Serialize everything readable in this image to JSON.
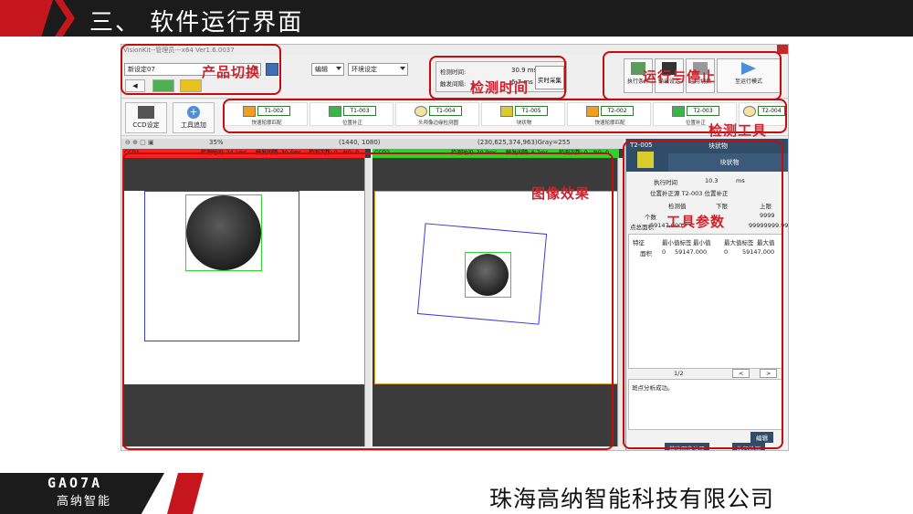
{
  "slide": {
    "title": "三、 软件运行界面",
    "company": "珠海高纳智能科技有限公司",
    "logo_mark": "GAO7A",
    "logo_cn": "高纳智能"
  },
  "app": {
    "window_title": "VisionKit--管理员---x64 Ver1.6.0037",
    "product_select": "新设定07",
    "menu_edit": "编辑",
    "menu_env": "环境设定",
    "stats": {
      "detect_time_label": "检测时间:",
      "detect_time_value": "30.9 ms",
      "trigger_interval_label": "触发间隔:",
      "trigger_interval_value": "6.7 ms",
      "realtime_button": "实时采集"
    },
    "run_buttons": [
      "执行条件",
      "输出设定",
      "运用切换",
      "至运行模式"
    ],
    "toolbar": {
      "ccd_setup": "CCD设定",
      "add_tool": "工具追加"
    },
    "tools": [
      {
        "id": "T1-002",
        "name": "快速轮廓匹配"
      },
      {
        "id": "T1-003",
        "name": "位置补正"
      },
      {
        "id": "T1-004",
        "name": "头颅像边缘检测圆"
      },
      {
        "id": "T1-005",
        "name": "块状物"
      },
      {
        "id": "T2-002",
        "name": "快速轮廓匹配"
      },
      {
        "id": "T2-003",
        "name": "位置补正"
      },
      {
        "id": "T2-004",
        "name": ""
      }
    ],
    "status": {
      "zoom": "35%",
      "size": "(1440, 1080)",
      "pixel": "(230,625,374,963)Gray=255"
    },
    "ccd1": {
      "label": "CCD1",
      "detect_time": "检测时间: 34.1ms",
      "trigger_interval": "触发间隔: 30.6ms",
      "count": "检测次数: 0",
      "ng": "NG: 0",
      "color": "#ff1f1f"
    },
    "ccd2": {
      "label": "CCD2",
      "detect_time": "检测时间: 30.9ms",
      "trigger_interval": "触发间隔: 6.7ms",
      "count": "检测次数: 0",
      "ng": "NG: 0",
      "color": "#2bd62b"
    },
    "panel": {
      "tool_id": "T2-005",
      "tool_name": "块状物",
      "tab": "块状物",
      "exec_time_label": "执行时间",
      "exec_time_value": "10.3",
      "exec_time_unit": "ms",
      "pos_correction": "位置补正源  T2-003 位置补正",
      "col_detect": "检测值",
      "col_lower": "下限",
      "col_upper": "上限",
      "row1_label": "个数",
      "row1_upper": "9999",
      "row2_label": "点总面积",
      "row2_value": "59147.000",
      "row2_upper": "99999999.999",
      "list_cols": [
        "特征",
        "最小值标签",
        "最小值",
        "最大值标签",
        "最大值"
      ],
      "list_row": [
        "面积",
        "0",
        "59147.000",
        "0",
        "59147.000"
      ],
      "page": "1/2",
      "log": "斑点分析成功。",
      "edit_button": "编辑",
      "bottom_btn1": "基准图像注册",
      "bottom_btn2": "执行检测"
    }
  },
  "annotations": {
    "product_switch": "产品切换",
    "detect_time": "检测时间",
    "run_stop": "运行与停止",
    "detect_tools": "检测工具",
    "image_effect": "图像效果",
    "tool_params": "工具参数"
  },
  "colors": {
    "accent_red": "#c4161c",
    "annotation_red": "#c40d0d",
    "header_dark": "#1b1b1b"
  }
}
